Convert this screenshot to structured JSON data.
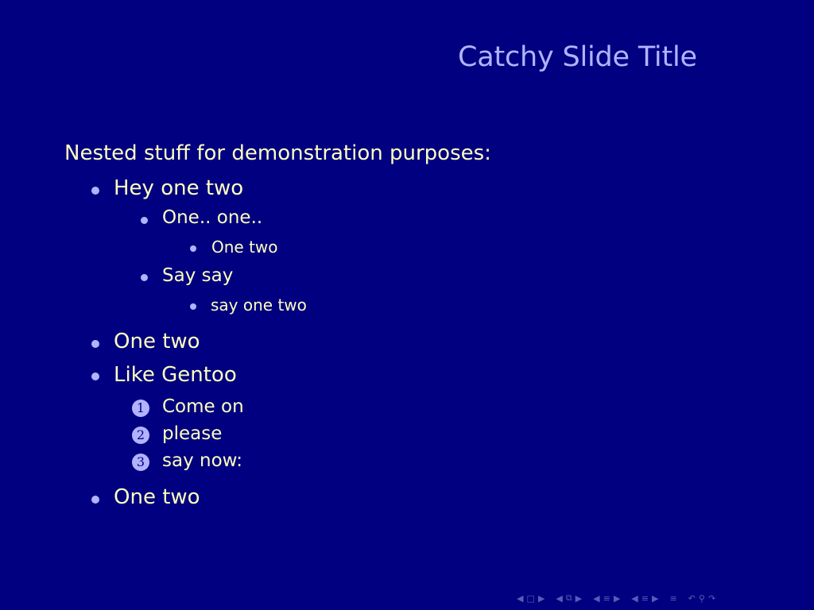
{
  "slide": {
    "title": "Catchy Slide Title",
    "intro": "Nested stuff for demonstration purposes:",
    "items": {
      "a": "Hey one two",
      "a1": "One.. one..",
      "a1a": "One two",
      "a2": "Say say",
      "a2a": "say one two",
      "b": "One two",
      "c": "Like Gentoo",
      "c1": "Come on",
      "c2": "please",
      "c3": "say now:",
      "d": "One two"
    },
    "numbers": [
      "1",
      "2",
      "3"
    ]
  },
  "colors": {
    "background": "#000080",
    "text": "#ffffbf",
    "title": "#b2b2ff",
    "bullet": "#b2b2ff"
  }
}
